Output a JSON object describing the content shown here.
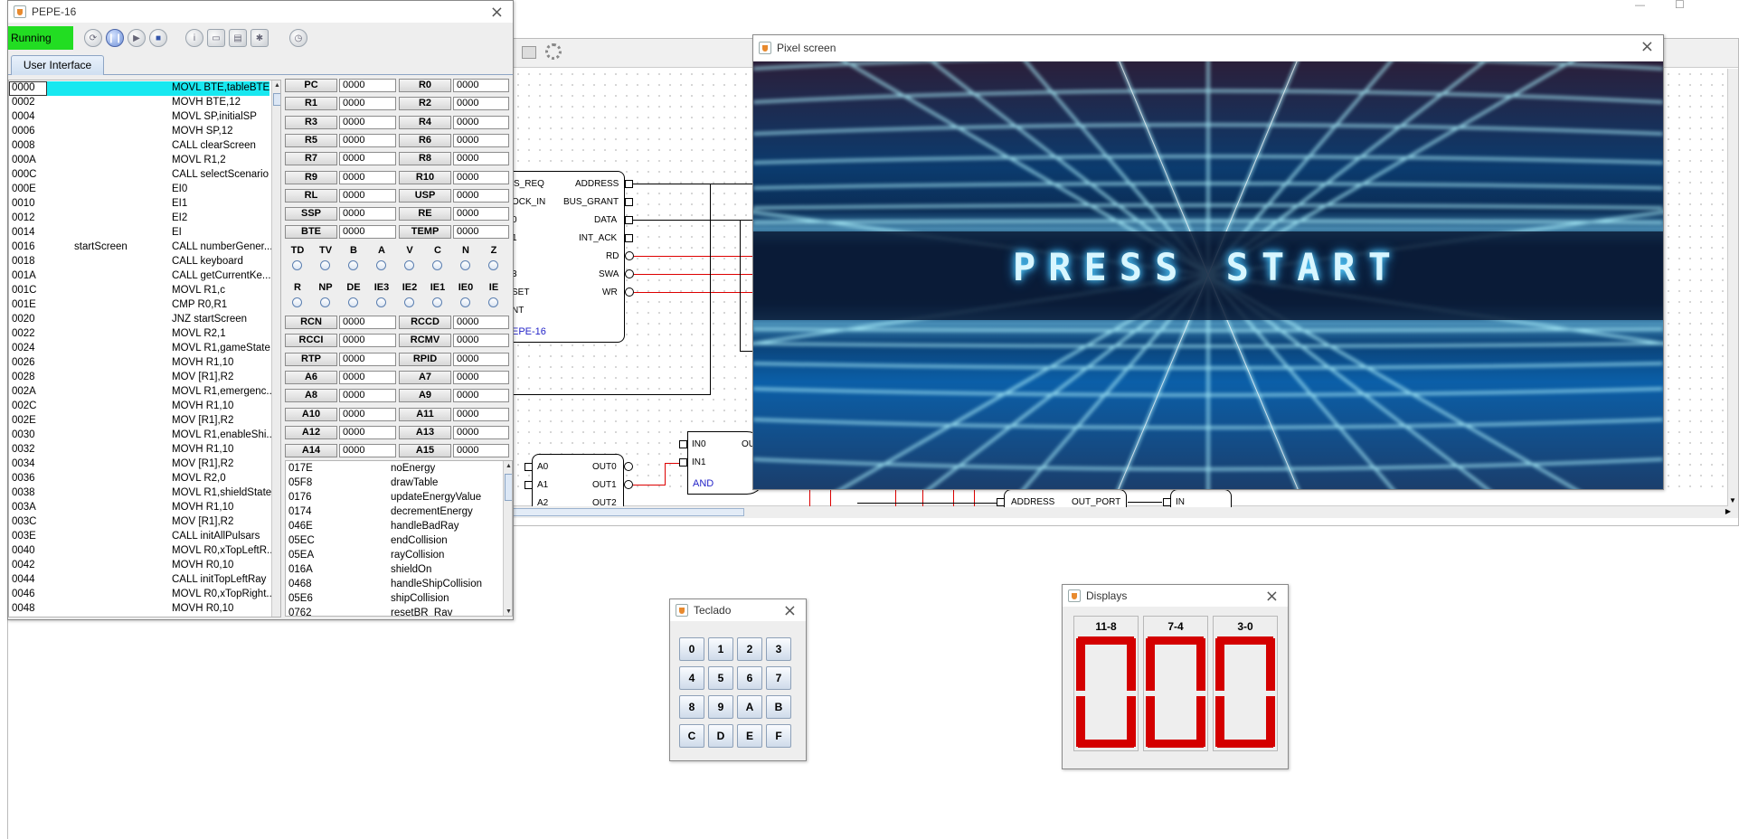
{
  "desktop": {
    "window_controls": {
      "minimize": "—",
      "maximize": "☐"
    }
  },
  "main_window": {
    "title": "PEPE-16",
    "status": "Running",
    "status_color": "#22dd22",
    "tab": "User Interface",
    "toolbar_icons": [
      "step-over-icon",
      "pause-icon",
      "play-icon",
      "stop-icon",
      "info-icon",
      "open-folder-icon",
      "save-icon",
      "settings-icon",
      "clock-icon"
    ],
    "code": [
      {
        "addr": "0000",
        "label": "",
        "instr": "MOVL BTE,tableBTE",
        "selected": true
      },
      {
        "addr": "0002",
        "label": "",
        "instr": "MOVH BTE,12"
      },
      {
        "addr": "0004",
        "label": "",
        "instr": "MOVL SP,initialSP"
      },
      {
        "addr": "0006",
        "label": "",
        "instr": "MOVH SP,12"
      },
      {
        "addr": "0008",
        "label": "",
        "instr": "CALL clearScreen"
      },
      {
        "addr": "000A",
        "label": "",
        "instr": "MOVL R1,2"
      },
      {
        "addr": "000C",
        "label": "",
        "instr": "CALL selectScenario"
      },
      {
        "addr": "000E",
        "label": "",
        "instr": "EI0"
      },
      {
        "addr": "0010",
        "label": "",
        "instr": "EI1"
      },
      {
        "addr": "0012",
        "label": "",
        "instr": "EI2"
      },
      {
        "addr": "0014",
        "label": "",
        "instr": "EI"
      },
      {
        "addr": "0016",
        "label": "startScreen",
        "instr": "CALL numberGener..."
      },
      {
        "addr": "0018",
        "label": "",
        "instr": "CALL keyboard"
      },
      {
        "addr": "001A",
        "label": "",
        "instr": "CALL getCurrentKe..."
      },
      {
        "addr": "001C",
        "label": "",
        "instr": "MOVL R1,c"
      },
      {
        "addr": "001E",
        "label": "",
        "instr": "CMP R0,R1"
      },
      {
        "addr": "0020",
        "label": "",
        "instr": "JNZ startScreen"
      },
      {
        "addr": "0022",
        "label": "",
        "instr": "MOVL R2,1"
      },
      {
        "addr": "0024",
        "label": "",
        "instr": "MOVL R1,gameState"
      },
      {
        "addr": "0026",
        "label": "",
        "instr": "MOVH R1,10"
      },
      {
        "addr": "0028",
        "label": "",
        "instr": "MOV [R1],R2"
      },
      {
        "addr": "002A",
        "label": "",
        "instr": "MOVL R1,emergenc..."
      },
      {
        "addr": "002C",
        "label": "",
        "instr": "MOVH R1,10"
      },
      {
        "addr": "002E",
        "label": "",
        "instr": "MOV [R1],R2"
      },
      {
        "addr": "0030",
        "label": "",
        "instr": "MOVL R1,enableShi..."
      },
      {
        "addr": "0032",
        "label": "",
        "instr": "MOVH R1,10"
      },
      {
        "addr": "0034",
        "label": "",
        "instr": "MOV [R1],R2"
      },
      {
        "addr": "0036",
        "label": "",
        "instr": "MOVL R2,0"
      },
      {
        "addr": "0038",
        "label": "",
        "instr": "MOVL R1,shieldState"
      },
      {
        "addr": "003A",
        "label": "",
        "instr": "MOVH R1,10"
      },
      {
        "addr": "003C",
        "label": "",
        "instr": "MOV [R1],R2"
      },
      {
        "addr": "003E",
        "label": "",
        "instr": "CALL initAllPulsars"
      },
      {
        "addr": "0040",
        "label": "",
        "instr": "MOVL R0,xTopLeftR..."
      },
      {
        "addr": "0042",
        "label": "",
        "instr": "MOVH R0,10"
      },
      {
        "addr": "0044",
        "label": "",
        "instr": "CALL initTopLeftRay"
      },
      {
        "addr": "0046",
        "label": "",
        "instr": "MOVL R0,xTopRight..."
      },
      {
        "addr": "0048",
        "label": "",
        "instr": "MOVH R0,10"
      }
    ],
    "registers": [
      [
        "PC",
        "0000",
        "R0",
        "0000"
      ],
      [
        "R1",
        "0000",
        "R2",
        "0000"
      ],
      [
        "R3",
        "0000",
        "R4",
        "0000"
      ],
      [
        "R5",
        "0000",
        "R6",
        "0000"
      ],
      [
        "R7",
        "0000",
        "R8",
        "0000"
      ],
      [
        "R9",
        "0000",
        "R10",
        "0000"
      ],
      [
        "RL",
        "0000",
        "USP",
        "0000"
      ],
      [
        "SSP",
        "0000",
        "RE",
        "0000"
      ],
      [
        "BTE",
        "0000",
        "TEMP",
        "0000"
      ]
    ],
    "flags1": [
      "TD",
      "TV",
      "B",
      "A",
      "V",
      "C",
      "N",
      "Z"
    ],
    "flags2": [
      "R",
      "NP",
      "DE",
      "IE3",
      "IE2",
      "IE1",
      "IE0",
      "IE"
    ],
    "registers2": [
      [
        "RCN",
        "0000",
        "RCCD",
        "0000"
      ],
      [
        "RCCI",
        "0000",
        "RCMV",
        "0000"
      ],
      [
        "RTP",
        "0000",
        "RPID",
        "0000"
      ],
      [
        "A6",
        "0000",
        "A7",
        "0000"
      ],
      [
        "A8",
        "0000",
        "A9",
        "0000"
      ],
      [
        "A10",
        "0000",
        "A11",
        "0000"
      ],
      [
        "A12",
        "0000",
        "A13",
        "0000"
      ],
      [
        "A14",
        "0000",
        "A15",
        "0000"
      ]
    ],
    "symbols": [
      [
        "017E",
        "noEnergy"
      ],
      [
        "05F8",
        "drawTable"
      ],
      [
        "0176",
        "updateEnergyValue"
      ],
      [
        "0174",
        "decrementEnergy"
      ],
      [
        "046E",
        "handleBadRay"
      ],
      [
        "05EC",
        "endCollision"
      ],
      [
        "05EA",
        "rayCollision"
      ],
      [
        "016A",
        "shieldOn"
      ],
      [
        "0468",
        "handleShipCollision"
      ],
      [
        "05E6",
        "shipCollision"
      ],
      [
        "0762",
        "resetBR_Ray"
      ]
    ]
  },
  "circuit": {
    "pepe_pins_left": [
      "S_REQ",
      "OCK_IN",
      "0",
      "1",
      "2",
      "3",
      "SET",
      "NT"
    ],
    "pepe_pins_right": [
      "ADDRESS",
      "BUS_GRANT",
      "DATA",
      "INT_ACK",
      "RD",
      "SWA",
      "WR"
    ],
    "pepe_name": "EPE-16",
    "dec_left": [
      "A0",
      "A1",
      "A2"
    ],
    "dec_right": [
      "OUT0",
      "OUT1",
      "OUT2"
    ],
    "and_inputs": [
      "IN0",
      "IN1"
    ],
    "and_label": "AND",
    "and_out": "OU",
    "bottom_labels": [
      "ADDRESS",
      "OUT_PORT",
      "IN"
    ]
  },
  "pixel_screen": {
    "title": "Pixel screen",
    "text": "PRESS START"
  },
  "keypad": {
    "title": "Teclado",
    "keys": [
      "0",
      "1",
      "2",
      "3",
      "4",
      "5",
      "6",
      "7",
      "8",
      "9",
      "A",
      "B",
      "C",
      "D",
      "E",
      "F"
    ]
  },
  "displays": {
    "title": "Displays",
    "labels": [
      "11-8",
      "7-4",
      "3-0"
    ],
    "segment_color": "#d40000"
  }
}
